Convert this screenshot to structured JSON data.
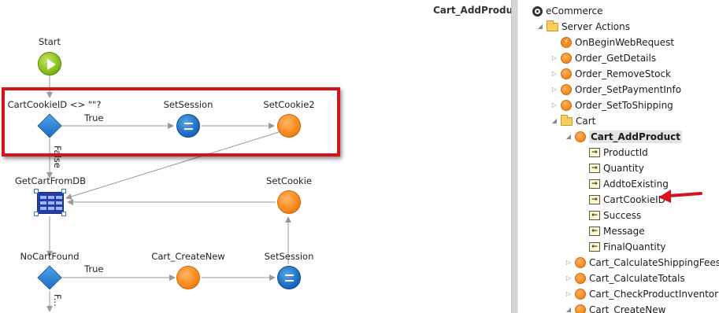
{
  "canvas": {
    "title": "Cart_AddProduct",
    "nodes": {
      "start": "Start",
      "if1": "CartCookieID <> \"\"?",
      "set_session_1": "SetSession",
      "set_cookie_2": "SetCookie2",
      "get_cart": "GetCartFromDB",
      "set_cookie": "SetCookie",
      "if2": "NoCartFound",
      "cart_create": "Cart_CreateNew",
      "set_session_2": "SetSession"
    },
    "edges": {
      "true_1": "True",
      "false_1": "False",
      "true_2": "True",
      "false_2": "F..."
    }
  },
  "tree": {
    "items": [
      {
        "label": "eCommerce",
        "icon": "module-icon",
        "arrow": ""
      },
      {
        "label": "Server Actions",
        "icon": "folder-icon",
        "arrow": "expanded"
      },
      {
        "label": "OnBeginWebRequest",
        "icon": "event-icon",
        "arrow": ""
      },
      {
        "label": "Order_GetDetails",
        "icon": "action-icon",
        "arrow": "collapsed"
      },
      {
        "label": "Order_RemoveStock",
        "icon": "action-icon",
        "arrow": "collapsed"
      },
      {
        "label": "Order_SetPaymentInfo",
        "icon": "action-icon",
        "arrow": "collapsed"
      },
      {
        "label": "Order_SetToShipping",
        "icon": "action-icon",
        "arrow": "collapsed"
      },
      {
        "label": "Cart",
        "icon": "folder-icon",
        "arrow": "expanded"
      },
      {
        "label": "Cart_AddProduct",
        "icon": "action-icon",
        "arrow": "expanded",
        "selected": true
      },
      {
        "label": "ProductId",
        "icon": "input-parameter-icon",
        "arrow": ""
      },
      {
        "label": "Quantity",
        "icon": "input-parameter-icon",
        "arrow": ""
      },
      {
        "label": "AddtoExisting",
        "icon": "input-parameter-icon",
        "arrow": ""
      },
      {
        "label": "CartCookieID",
        "icon": "input-parameter-icon",
        "arrow": ""
      },
      {
        "label": "Success",
        "icon": "output-parameter-icon",
        "arrow": ""
      },
      {
        "label": "Message",
        "icon": "output-parameter-icon",
        "arrow": ""
      },
      {
        "label": "FinalQuantity",
        "icon": "output-parameter-icon",
        "arrow": ""
      },
      {
        "label": "Cart_CalculateShippingFees",
        "icon": "action-icon",
        "arrow": "collapsed"
      },
      {
        "label": "Cart_CalculateTotals",
        "icon": "action-icon",
        "arrow": "collapsed"
      },
      {
        "label": "Cart_CheckProductInventory",
        "icon": "action-icon",
        "arrow": "collapsed"
      },
      {
        "label": "Cart_CreateNew",
        "icon": "action-icon",
        "arrow": "expanded"
      }
    ]
  },
  "colors": {
    "highlight": "#d3141a",
    "annotation_arrow": "#d3141a",
    "selected_row": "#e3e3e3"
  }
}
